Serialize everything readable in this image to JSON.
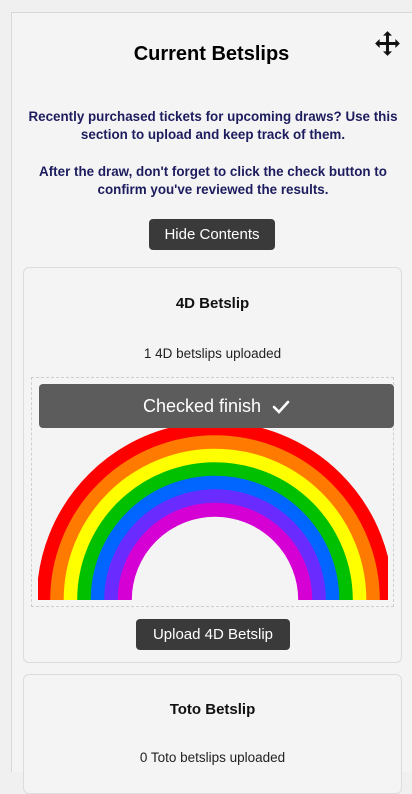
{
  "header": {
    "title": "Current Betslips",
    "move_icon": "move-arrows-icon"
  },
  "description": {
    "line1": "Recently purchased tickets for upcoming draws? Use this section to upload and keep track of them.",
    "line2": "After the draw, don't forget to click the check button to confirm you've reviewed the results."
  },
  "hide_button_label": "Hide Contents",
  "cards": {
    "fourd": {
      "title": "4D Betslip",
      "status": "1 4D betslips uploaded",
      "checked_label": "Checked finish",
      "upload_label": "Upload 4D Betslip"
    },
    "toto": {
      "title": "Toto Betslip",
      "status": "0 Toto betslips uploaded"
    }
  },
  "colors": {
    "button_bg": "#3a3a3a",
    "banner_bg": "#5c5c5c",
    "description_text": "#1c1c5e",
    "rainbow": [
      "#ff0000",
      "#ff7a00",
      "#ffff00",
      "#00c000",
      "#0066ff",
      "#6a2bff",
      "#d400d4"
    ]
  }
}
